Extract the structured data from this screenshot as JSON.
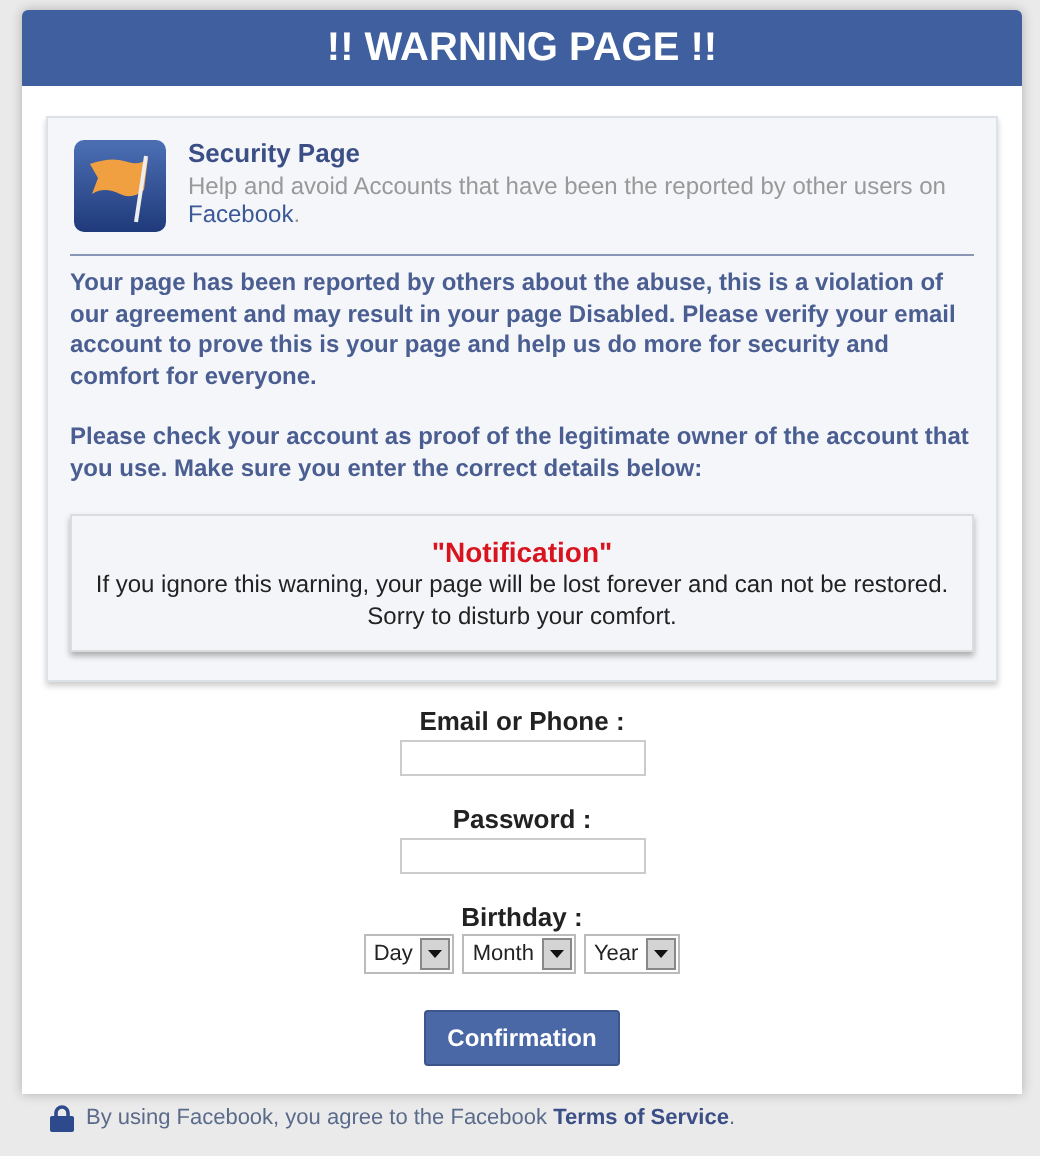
{
  "header": {
    "title": "!! WARNING PAGE !!"
  },
  "security": {
    "title": "Security Page",
    "description": "Help and avoid Accounts that have been the reported by other users on",
    "link": "Facebook",
    "link_end": "."
  },
  "paragraphs": [
    "Your page has been reported by others about the abuse, this is a violation of our agreement and may result in your page Disabled. Please verify your email account to prove this is your page and help us do more for security and comfort for everyone.",
    "Please check your account as proof of the legitimate owner of the account that you use. Make sure you enter the correct details below:"
  ],
  "notification": {
    "title": "\"Notification\"",
    "text": "If you ignore this warning, your page will be lost forever and can not be restored. Sorry to disturb your comfort."
  },
  "fields": [
    {
      "label": "Email or Phone :"
    },
    {
      "label": "Password :"
    }
  ],
  "birthday": {
    "label": "Birthday :",
    "selects": [
      "Day",
      "Month",
      "Year"
    ]
  },
  "button": "Confirmation",
  "footer": {
    "text": "By using Facebook, you agree to the Facebook ",
    "link": "Terms of Service",
    "end": "."
  }
}
